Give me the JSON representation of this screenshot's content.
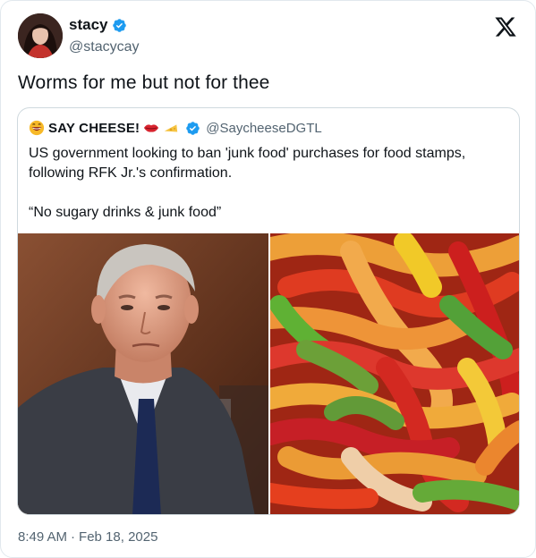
{
  "author": {
    "name": "stacy",
    "handle": "@stacycay"
  },
  "tweet": {
    "text": "Worms for me but not for thee"
  },
  "quoted": {
    "name": "SAY CHEESE!",
    "handle": "@SaycheeseDGTL",
    "text_line1": "US government looking to ban 'junk food' purchases for food stamps, following RFK Jr.'s confirmation.",
    "text_line2": "“No sugary drinks & junk food”"
  },
  "meta": {
    "time": "8:49 AM",
    "separator": "·",
    "date": "Feb 18, 2025"
  },
  "colors": {
    "verified_blue": "#1d9bf0",
    "muted_text": "#536471"
  },
  "icons": [
    "verified-badge-icon",
    "x-logo-icon",
    "grinning-emoji-icon",
    "lips-emoji-icon",
    "cheese-emoji-icon"
  ]
}
